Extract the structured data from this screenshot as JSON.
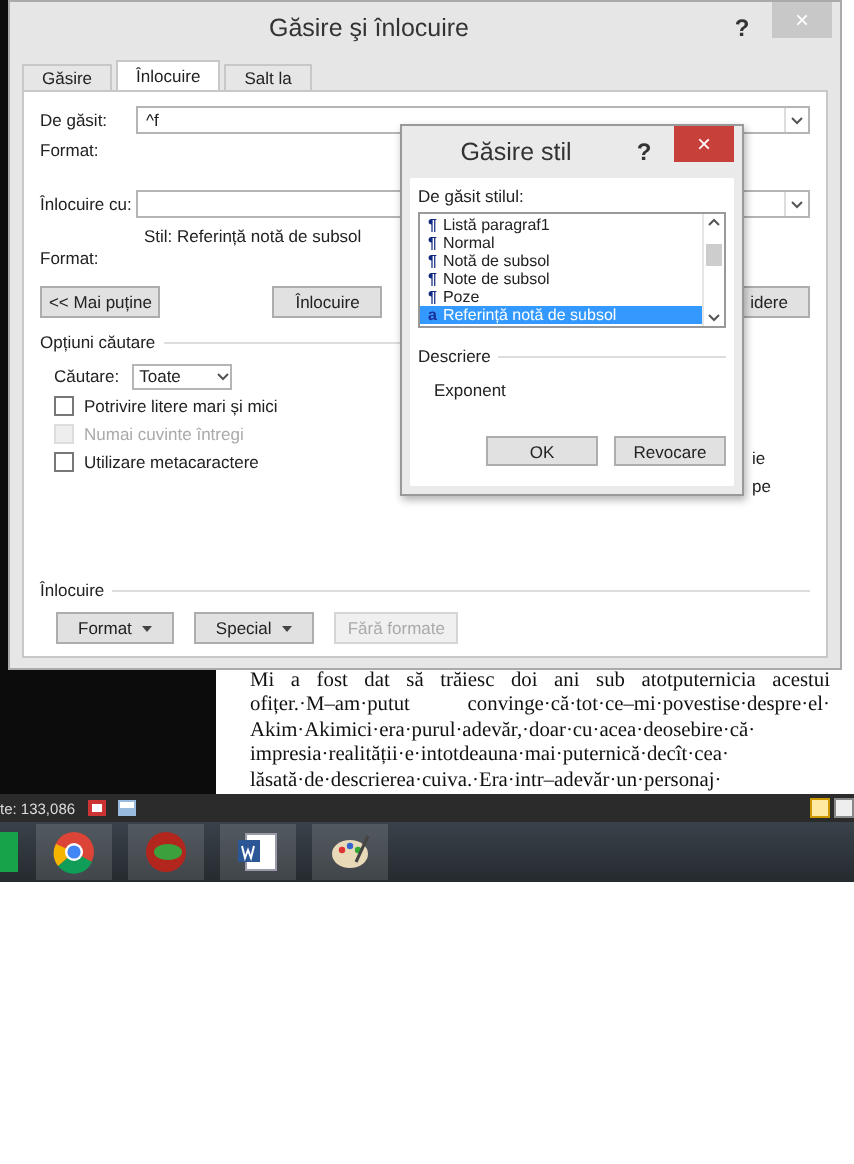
{
  "main_dialog": {
    "title": "Găsire şi înlocuire",
    "help": "?",
    "close": "×",
    "tabs": [
      {
        "label": "Găsire",
        "selected": false
      },
      {
        "label": "Înlocuire",
        "selected": true
      },
      {
        "label": "Salt la",
        "selected": false
      }
    ],
    "find": {
      "label": "De găsit:",
      "value": "^f",
      "format_label": "Format:"
    },
    "replace": {
      "label": "Înlocuire cu:",
      "style_note": "Stil: Referință notă de subsol",
      "format_label": "Format:"
    },
    "buttons": [
      "<< Mai puține",
      "Înlocuire",
      "idere"
    ],
    "search_options": {
      "title": "Opțiuni căutare",
      "search_label": "Căutare:",
      "search_value": "Toate",
      "checkboxes": [
        {
          "label": "Potrivire litere mari și mici",
          "checked": false,
          "disabled": false
        },
        {
          "label": "Numai cuvinte întregi",
          "checked": false,
          "disabled": true
        },
        {
          "label": "Utilizare metacaractere",
          "checked": false,
          "disabled": false
        }
      ],
      "right_fragments": [
        "ie",
        "pe"
      ]
    },
    "replace_section": {
      "title": "Înlocuire",
      "buttons": [
        {
          "label": "Format",
          "dropdown": true,
          "disabled": false
        },
        {
          "label": "Special",
          "dropdown": true,
          "disabled": false
        },
        {
          "label": "Fără formate",
          "dropdown": false,
          "disabled": true
        }
      ]
    }
  },
  "style_dialog": {
    "title": "Găsire stil",
    "help": "?",
    "close": "×",
    "list_label": "De găsit stilul:",
    "styles": [
      {
        "mark": "¶",
        "name": "Listă paragraf1",
        "selected": false
      },
      {
        "mark": "¶",
        "name": "Normal",
        "selected": false
      },
      {
        "mark": "¶",
        "name": "Notă de subsol",
        "selected": false
      },
      {
        "mark": "¶",
        "name": "Note de subsol",
        "selected": false
      },
      {
        "mark": "¶",
        "name": "Poze",
        "selected": false
      },
      {
        "mark": "a",
        "name": "Referință notă de subsol",
        "selected": true
      }
    ],
    "description_title": "Descriere",
    "description": "Exponent",
    "buttons": [
      "OK",
      "Revocare"
    ]
  },
  "document": {
    "lines": [
      "Mi a fost dat să trăiesc doi ani sub atotputernicia acestui",
      "ofițer.·M–am·putut convinge·că·tot·ce–mi·povestise·despre·el·",
      "Akim·Akimici·era·purul·adevăr,·doar·cu·acea·deosebire·că·",
      "impresia·realității·e·intotdeauna·mai·puternică·decît·cea·",
      "lăsată·de·descrierea·cuiva.·Era·intr–adevăr·un·personaj·"
    ]
  },
  "status_bar": {
    "text": "te: 133,086"
  },
  "taskbar": {
    "apps": [
      {
        "kind": "tile"
      },
      {
        "kind": "browser"
      },
      {
        "kind": "disc"
      },
      {
        "kind": "document"
      },
      {
        "kind": "palette"
      }
    ]
  }
}
